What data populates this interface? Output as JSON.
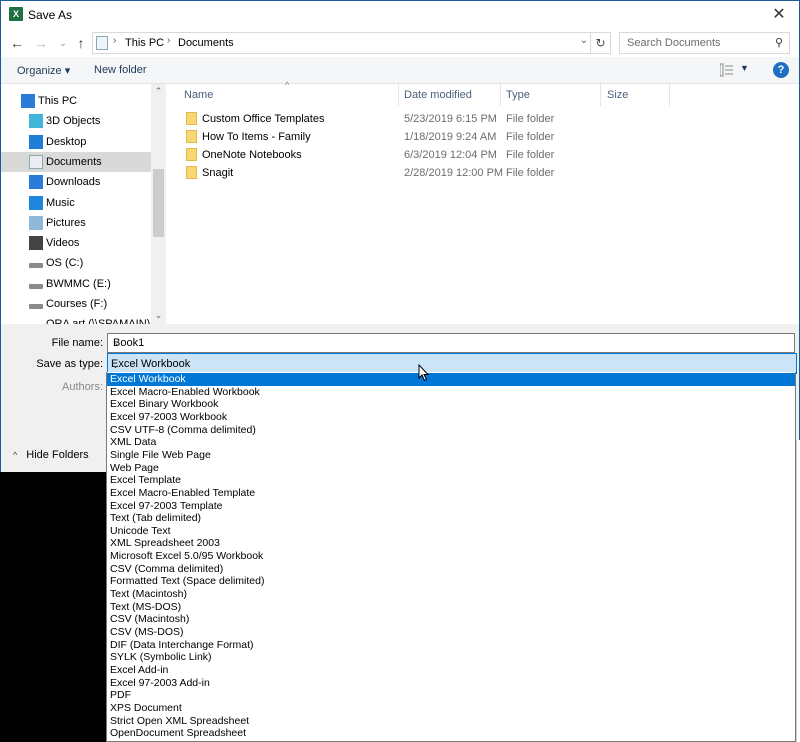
{
  "window": {
    "title": "Save As",
    "app_icon": "excel-icon",
    "close_icon": "close-icon"
  },
  "navbar": {
    "back_icon": "back-arrow-icon",
    "forward_icon": "forward-arrow-icon",
    "recent_icon": "chevron-down-icon",
    "up_icon": "up-arrow-icon",
    "breadcrumb": [
      "This PC",
      "Documents"
    ],
    "refresh_icon": "refresh-icon",
    "search_placeholder": "Search Documents"
  },
  "toolbar": {
    "organize": "Organize ▾",
    "new_folder": "New folder",
    "help": "?"
  },
  "sidebar": {
    "items": [
      {
        "label": "This PC",
        "icon": "computer-icon"
      },
      {
        "label": "3D Objects",
        "icon": "3d-objects-icon"
      },
      {
        "label": "Desktop",
        "icon": "desktop-icon"
      },
      {
        "label": "Documents",
        "icon": "documents-icon",
        "selected": true
      },
      {
        "label": "Downloads",
        "icon": "download-icon"
      },
      {
        "label": "Music",
        "icon": "music-icon"
      },
      {
        "label": "Pictures",
        "icon": "pictures-icon"
      },
      {
        "label": "Videos",
        "icon": "videos-icon"
      },
      {
        "label": "OS (C:)",
        "icon": "drive-icon"
      },
      {
        "label": "BWMMC (E:)",
        "icon": "drive-icon"
      },
      {
        "label": "Courses (F:)",
        "icon": "drive-icon"
      },
      {
        "label": "ORA art (\\\\SPAMAIN) (G:)",
        "icon": "network-drive-icon"
      }
    ]
  },
  "files": {
    "columns": [
      "Name",
      "Date modified",
      "Type",
      "Size"
    ],
    "rows": [
      {
        "name": "Custom Office Templates",
        "date": "5/23/2019 6:15 PM",
        "type": "File folder"
      },
      {
        "name": "How To Items - Family",
        "date": "1/18/2019 9:24 AM",
        "type": "File folder"
      },
      {
        "name": "OneNote Notebooks",
        "date": "6/3/2019 12:04 PM",
        "type": "File folder"
      },
      {
        "name": "Snagit",
        "date": "2/28/2019 12:00 PM",
        "type": "File folder"
      }
    ]
  },
  "form": {
    "file_name_label": "File name:",
    "file_name_value": "Book1",
    "save_type_label": "Save as type:",
    "save_type_value": "Excel Workbook",
    "authors_label": "Authors:",
    "hide_folders": "Hide Folders"
  },
  "type_options": [
    "Excel Workbook",
    "Excel Macro-Enabled Workbook",
    "Excel Binary Workbook",
    "Excel 97-2003 Workbook",
    "CSV UTF-8 (Comma delimited)",
    "XML Data",
    "Single File Web Page",
    "Web Page",
    "Excel Template",
    "Excel Macro-Enabled Template",
    "Excel 97-2003 Template",
    "Text (Tab delimited)",
    "Unicode Text",
    "XML Spreadsheet 2003",
    "Microsoft Excel 5.0/95 Workbook",
    "CSV (Comma delimited)",
    "Formatted Text (Space delimited)",
    "Text (Macintosh)",
    "Text (MS-DOS)",
    "CSV (Macintosh)",
    "CSV (MS-DOS)",
    "DIF (Data Interchange Format)",
    "SYLK (Symbolic Link)",
    "Excel Add-in",
    "Excel 97-2003 Add-in",
    "PDF",
    "XPS Document",
    "Strict Open XML Spreadsheet",
    "OpenDocument Spreadsheet"
  ],
  "colors": {
    "accent": "#0078d7",
    "selected_field": "#cce4f7",
    "folder": "#f8d775",
    "excel": "#1e7145"
  }
}
